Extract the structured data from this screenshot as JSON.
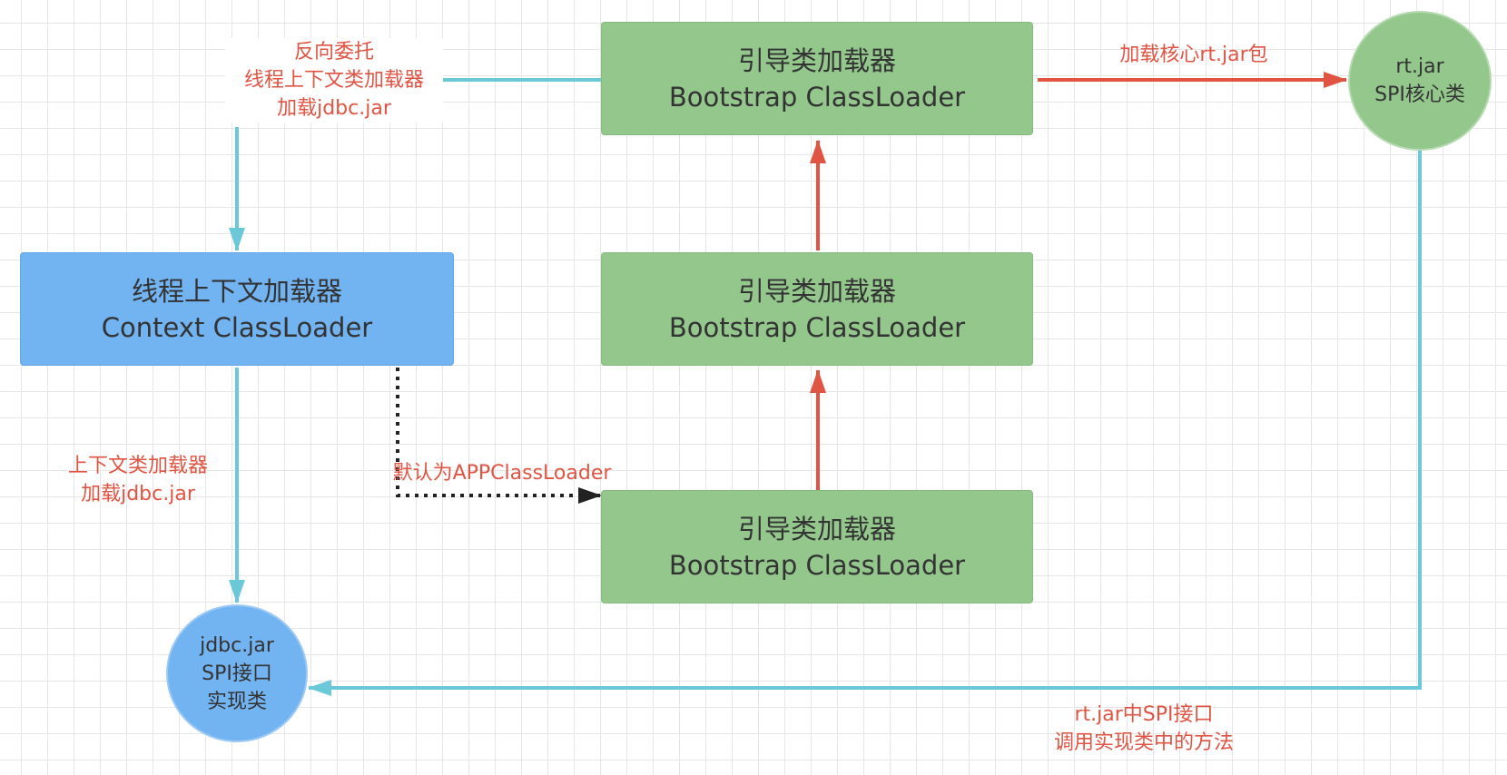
{
  "colors": {
    "green_node": "#93c78c",
    "blue_node": "#72b3f1",
    "red_arrow": "#e05443",
    "cyan_arrow": "#6bc8d8",
    "dotted_arrow": "#222222",
    "label_text": "#e05443"
  },
  "nodes": {
    "bootstrap_top": {
      "line1": "引导类加载器",
      "line2": "Bootstrap ClassLoader"
    },
    "bootstrap_mid": {
      "line1": "引导类加载器",
      "line2": "Bootstrap ClassLoader"
    },
    "bootstrap_bottom": {
      "line1": "引导类加载器",
      "line2": "Bootstrap ClassLoader"
    },
    "context_loader": {
      "line1": "线程上下文加载器",
      "line2": "Context ClassLoader"
    },
    "rt_jar": {
      "line1": "rt.jar",
      "line2": "SPI核心类"
    },
    "jdbc_jar": {
      "line1": "jdbc.jar",
      "line2": "SPI接口",
      "line3": "实现类"
    }
  },
  "labels": {
    "reverse_delegation": {
      "line1": "反向委托",
      "line2": "线程上下文类加载器",
      "line3": "加载jdbc.jar"
    },
    "load_core": "加载核心rt.jar包",
    "context_load": {
      "line1": "上下文类加载器",
      "line2": "加载jdbc.jar"
    },
    "default_app": "默认为APPClassLoader",
    "spi_call": {
      "line1": "rt.jar中SPI接口",
      "line2": "调用实现类中的方法"
    }
  }
}
